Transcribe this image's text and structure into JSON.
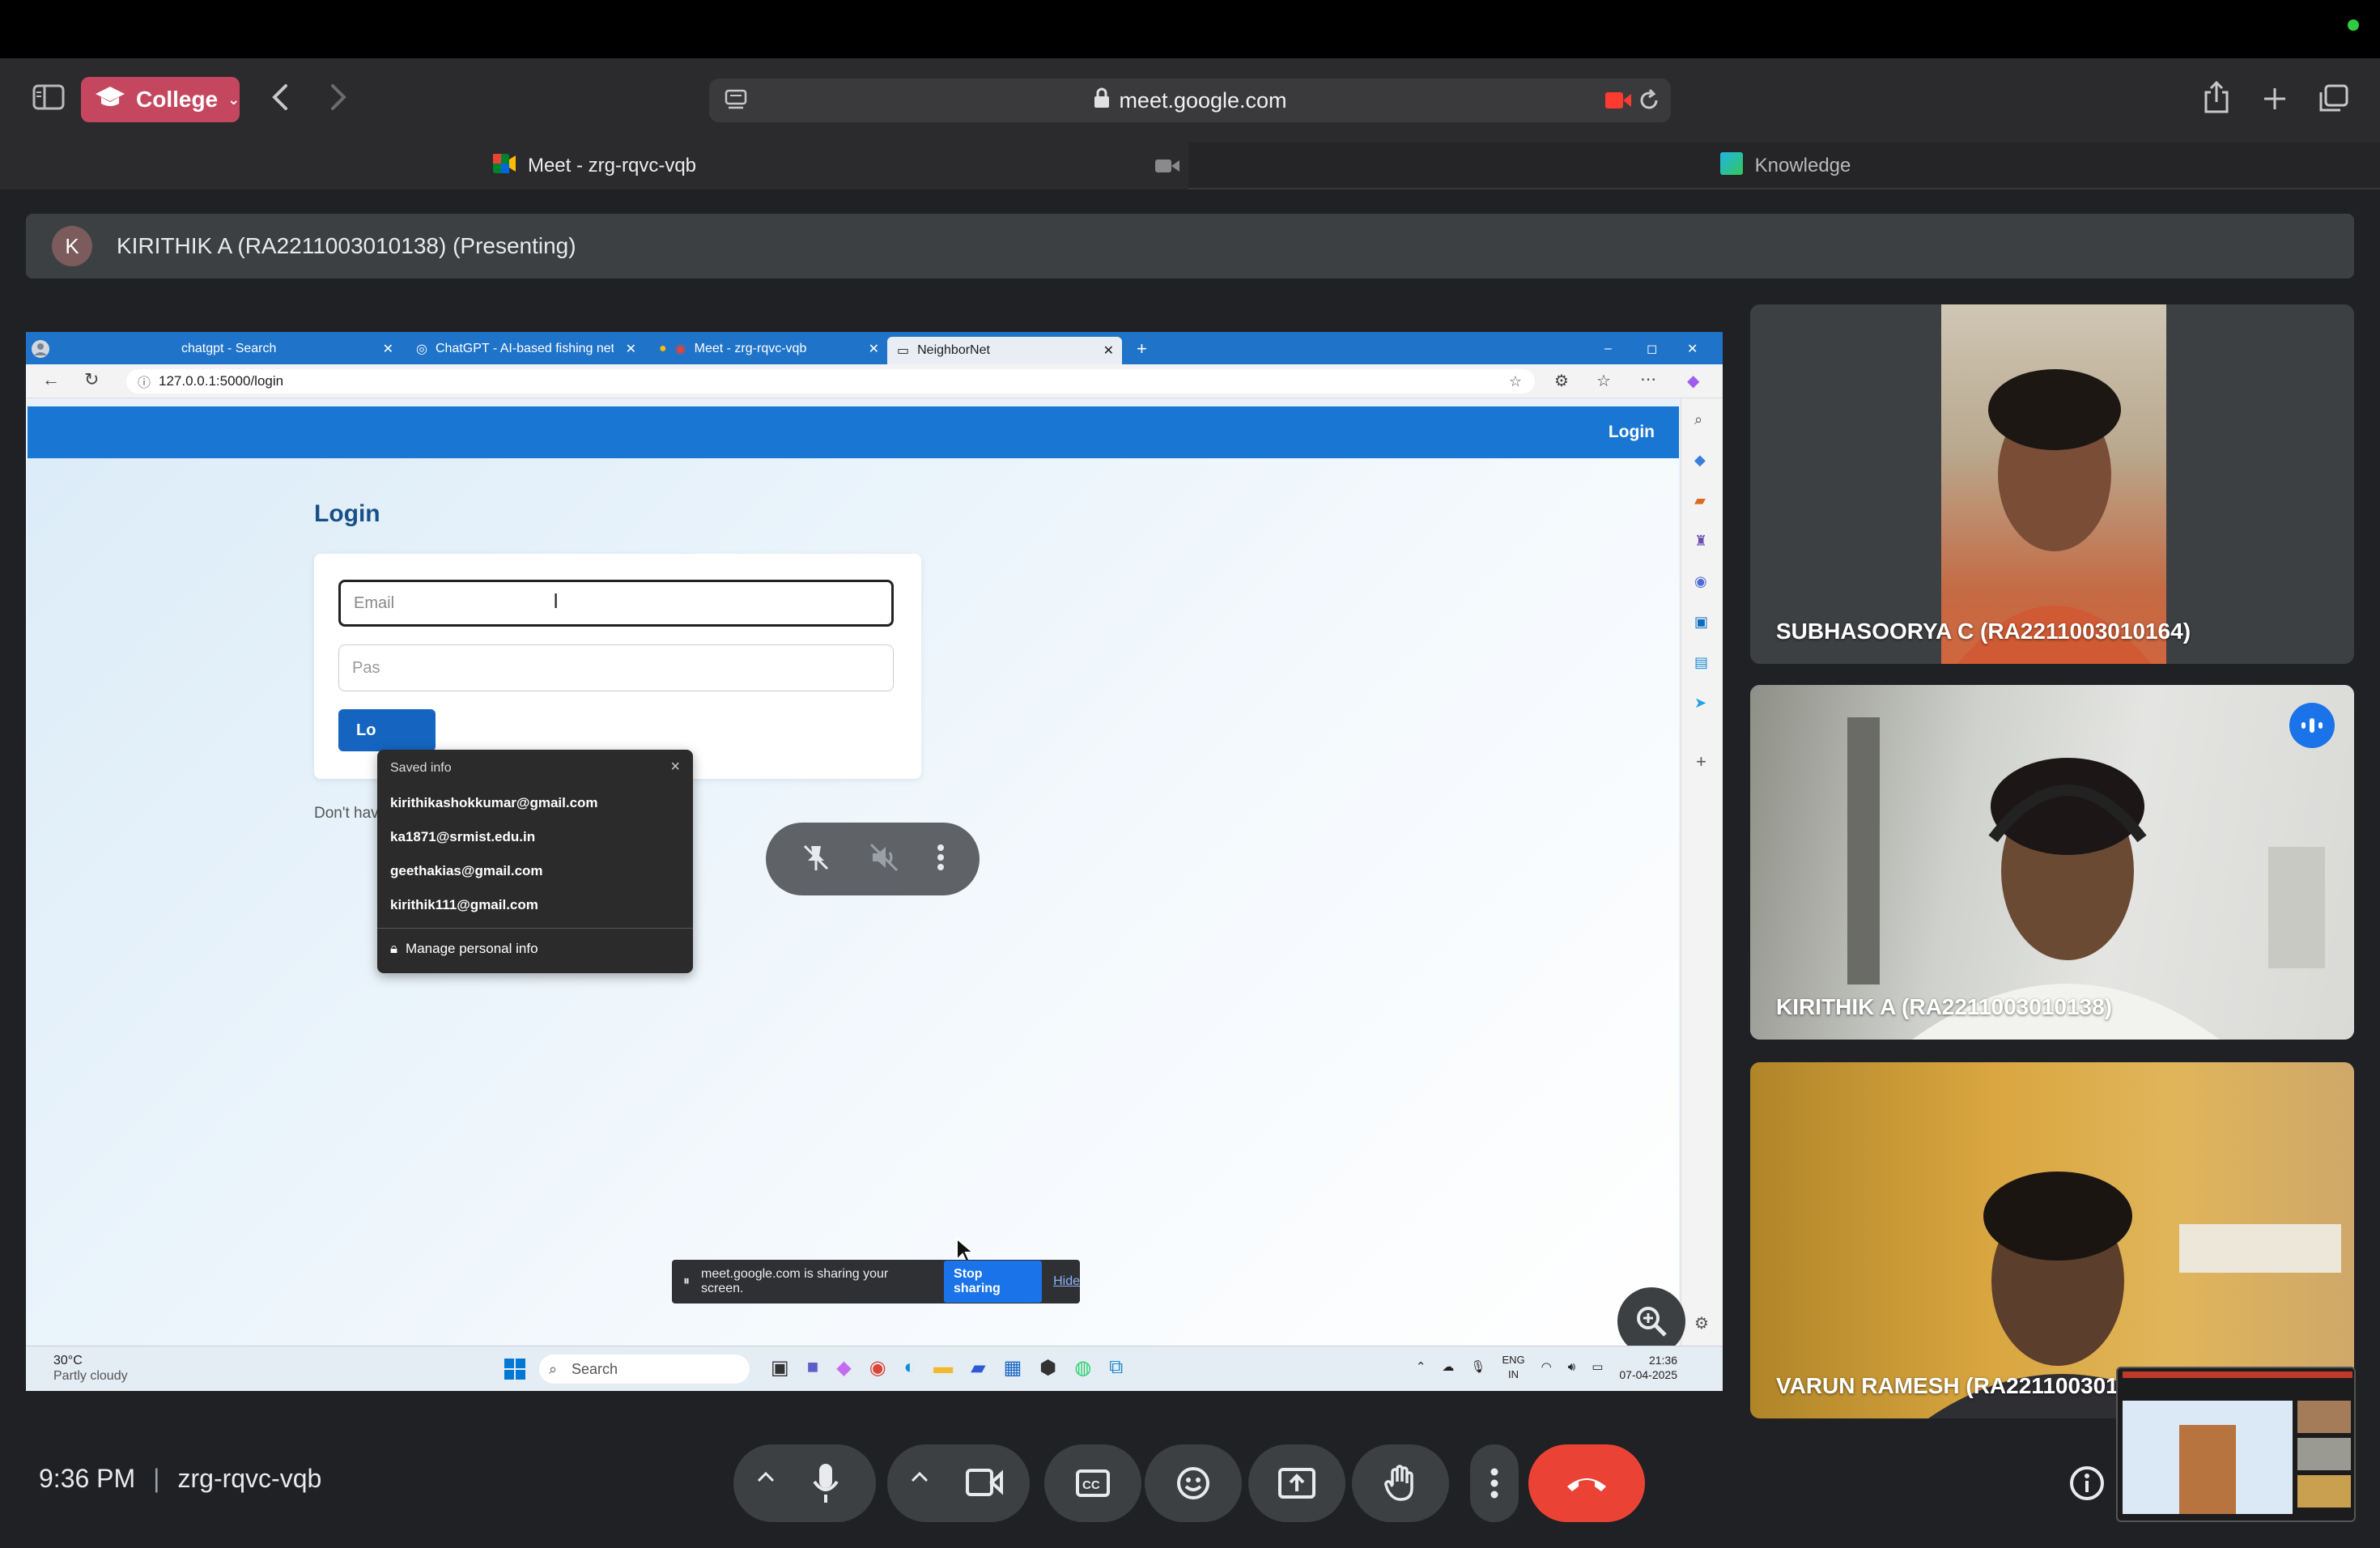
{
  "browser": {
    "profile_label": "College",
    "url": "meet.google.com",
    "tabs": [
      {
        "label": "Meet - zrg-rqvc-vqb"
      },
      {
        "label": "Knowledge"
      }
    ]
  },
  "meet": {
    "presenter_initial": "K",
    "presenter_label": "KIRITHIK A (RA2211003010138) (Presenting)",
    "time": "9:36 PM",
    "meeting_code": "zrg-rqvc-vqb",
    "participants": [
      {
        "name": "SUBHASOORYA C (RA2211003010164)"
      },
      {
        "name": "KIRITHIK A (RA2211003010138)"
      },
      {
        "name": "VARUN RAMESH (RA221100301"
      }
    ]
  },
  "shared_screen": {
    "edge_tabs": [
      {
        "label": "chatgpt - Search"
      },
      {
        "label": "ChatGPT - AI-based fishing net tr"
      },
      {
        "label": "Meet - zrg-rqvc-vqb"
      },
      {
        "label": "NeighborNet"
      }
    ],
    "address": "127.0.0.1:5000/login",
    "nav_login": "Login",
    "page_title": "Login",
    "email_placeholder": "Email",
    "password_placeholder": "Pas",
    "login_button": "Lo",
    "dont_have": "Don't hav",
    "autofill": {
      "header": "Saved info",
      "emails": [
        "kirithikashokkumar@gmail.com",
        "ka1871@srmist.edu.in",
        "geethakias@gmail.com",
        "kirithik111@gmail.com"
      ],
      "manage": "Manage personal info"
    },
    "share_banner": {
      "text": "meet.google.com is sharing your screen.",
      "stop": "Stop sharing",
      "hide": "Hide"
    },
    "taskbar": {
      "temp": "30°C",
      "weather": "Partly cloudy",
      "search": "Search",
      "lang": "ENG",
      "region": "IN",
      "time": "21:36",
      "date": "07-04-2025"
    }
  }
}
